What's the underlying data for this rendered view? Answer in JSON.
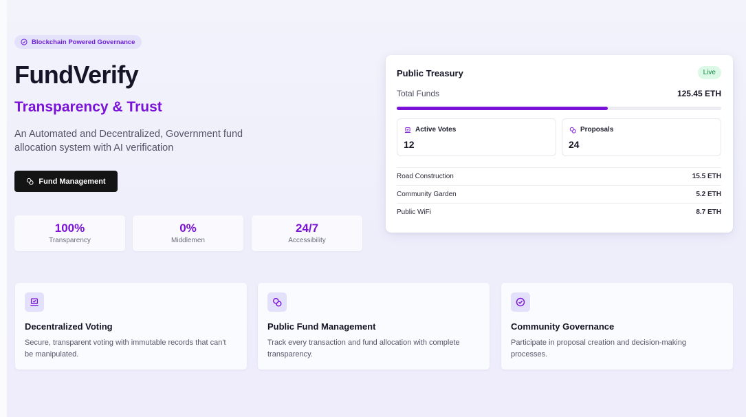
{
  "hero": {
    "badge": "Blockchain Powered Governance",
    "title": "FundVerify",
    "subtitle": "Transparency & Trust",
    "description": "An Automated and Decentralized, Government fund allocation system with AI verification",
    "button_label": "Fund Management",
    "stats": [
      {
        "value": "100%",
        "label": "Transparency"
      },
      {
        "value": "0%",
        "label": "Middlemen"
      },
      {
        "value": "24/7",
        "label": "Accessibility"
      }
    ]
  },
  "treasury": {
    "title": "Public Treasury",
    "status": "Live",
    "total_label": "Total Funds",
    "total_value": "125.45 ETH",
    "progress_fraction": 0.65,
    "active_votes": {
      "label": "Active Votes",
      "value": "12"
    },
    "proposals": {
      "label": "Proposals",
      "value": "24"
    },
    "projects": [
      {
        "name": "Road Construction",
        "amount": "15.5 ETH"
      },
      {
        "name": "Community Garden",
        "amount": "5.2 ETH"
      },
      {
        "name": "Public WiFi",
        "amount": "8.7 ETH"
      }
    ]
  },
  "features": [
    {
      "icon": "vote-box-icon",
      "title": "Decentralized Voting",
      "description": "Secure, transparent voting with immutable records that can't be manipulated."
    },
    {
      "icon": "coins-icon",
      "title": "Public Fund Management",
      "description": "Track every transaction and fund allocation with complete transparency."
    },
    {
      "icon": "check-circle-icon",
      "title": "Community Governance",
      "description": "Participate in proposal creation and decision-making processes."
    }
  ],
  "colors": {
    "accent": "#7a12d8",
    "live": "#10883e",
    "button": "#141414"
  }
}
